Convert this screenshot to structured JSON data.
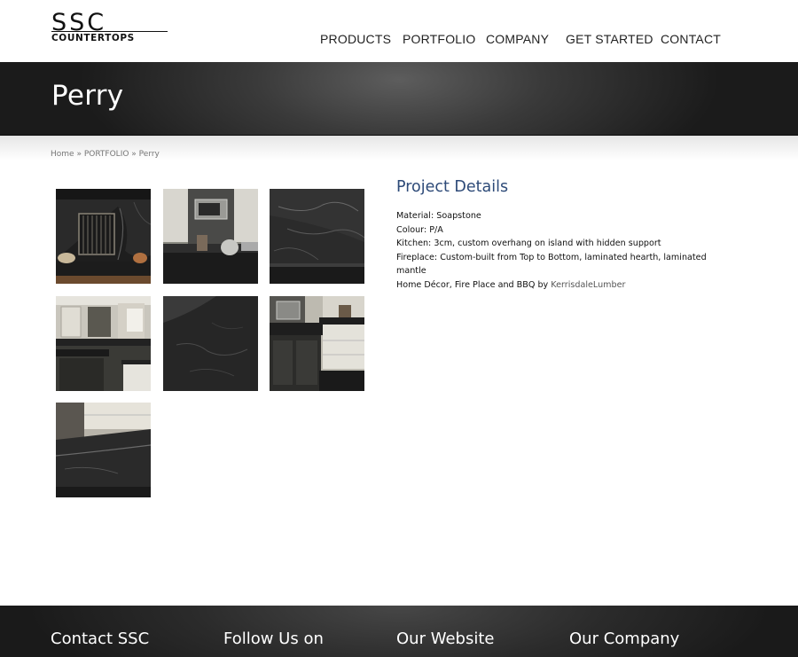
{
  "logo": {
    "top_text": "SSC",
    "bottom_text": "COUNTERTOPS"
  },
  "nav": {
    "items": [
      "PRODUCTS",
      "PORTFOLIO",
      "COMPANY",
      "GET STARTED",
      "CONTACT"
    ]
  },
  "page": {
    "title": "Perry"
  },
  "breadcrumb": {
    "home": "Home",
    "sep1": " » ",
    "section": "PORTFOLIO",
    "sep2": " » ",
    "current": "Perry"
  },
  "gallery": {
    "images": [
      "fireplace-icon",
      "kitchen-range-icon",
      "soapstone-closeup-icon",
      "kitchen-island-icon",
      "soapstone-surface-icon",
      "kitchen-cabinets-icon",
      "countertop-edge-icon"
    ]
  },
  "details": {
    "heading": "Project Details",
    "material": "Material: Soapstone",
    "colour": "Colour: P/A",
    "kitchen": "Kitchen: 3cm, custom overhang on island with hidden support",
    "fireplace": "Fireplace: Custom-built from Top to Bottom, laminated hearth, laminated mantle",
    "decor_prefix": "Home Décor, Fire Place and BBQ by ",
    "decor_link": "KerrisdaleLumber"
  },
  "footer": {
    "headings": [
      "Contact SSC",
      "Follow Us on",
      "Our Website",
      "Our Company"
    ]
  },
  "colors": {
    "heading_blue": "#2d4a78",
    "band_dark": "#1b1b1b",
    "footer_dark": "#1a1a1a"
  }
}
